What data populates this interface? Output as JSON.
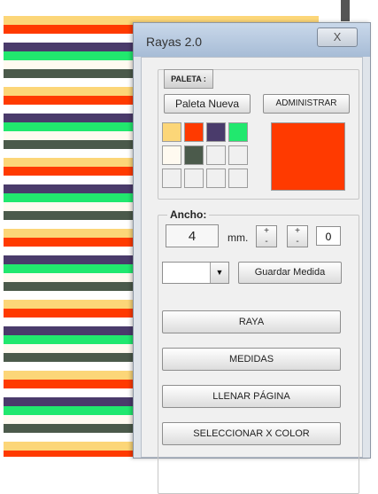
{
  "stripes": [
    "#fcd678",
    "#ff3a00",
    "#ffffff",
    "#4a3b6b",
    "#21e86e",
    "#fffaf0",
    "#4b5a4b",
    "#ffffff",
    "#fcd678",
    "#ff3a00",
    "#ffffff",
    "#4a3b6b",
    "#21e86e",
    "#fffaf0",
    "#4b5a4b",
    "#ffffff",
    "#fcd678",
    "#ff3a00",
    "#ffffff",
    "#4a3b6b",
    "#21e86e",
    "#fffaf0",
    "#4b5a4b",
    "#ffffff",
    "#fcd678",
    "#ff3a00",
    "#ffffff",
    "#4a3b6b",
    "#21e86e",
    "#fffaf0",
    "#4b5a4b",
    "#ffffff",
    "#fcd678",
    "#ff3a00",
    "#ffffff",
    "#4a3b6b",
    "#21e86e",
    "#fffaf0",
    "#4b5a4b",
    "#ffffff",
    "#fcd678",
    "#ff3a00",
    "#ffffff",
    "#4a3b6b",
    "#21e86e",
    "#fffaf0",
    "#4b5a4b",
    "#ffffff",
    "#fcd678",
    "#ff3a00"
  ],
  "window": {
    "title": "Rayas 2.0",
    "close_label": "X"
  },
  "paleta": {
    "tab_label": "PALETA :",
    "new_button": "Paleta Nueva",
    "admin_button": "ADMINISTRAR",
    "swatches": [
      "#fcd678",
      "#ff3a00",
      "#4a3b6b",
      "#21e86e",
      "#fffaf0",
      "#4b5a4b",
      "#f0f0f0",
      "#f0f0f0",
      "#f0f0f0",
      "#f0f0f0",
      "#f0f0f0",
      "#f0f0f0"
    ],
    "selected_color": "#ff3a00"
  },
  "ancho": {
    "label": "Ancho:",
    "value": "4",
    "unit": "mm.",
    "spinner_up": "+",
    "spinner_down": "-",
    "count": "0",
    "dropdown_value": "",
    "save_button": "Guardar Medida"
  },
  "actions": {
    "raya": "RAYA",
    "medidas": "MEDIDAS",
    "llenar": "LLENAR PÁGINA",
    "seleccionar": "SELECCIONAR X COLOR"
  }
}
